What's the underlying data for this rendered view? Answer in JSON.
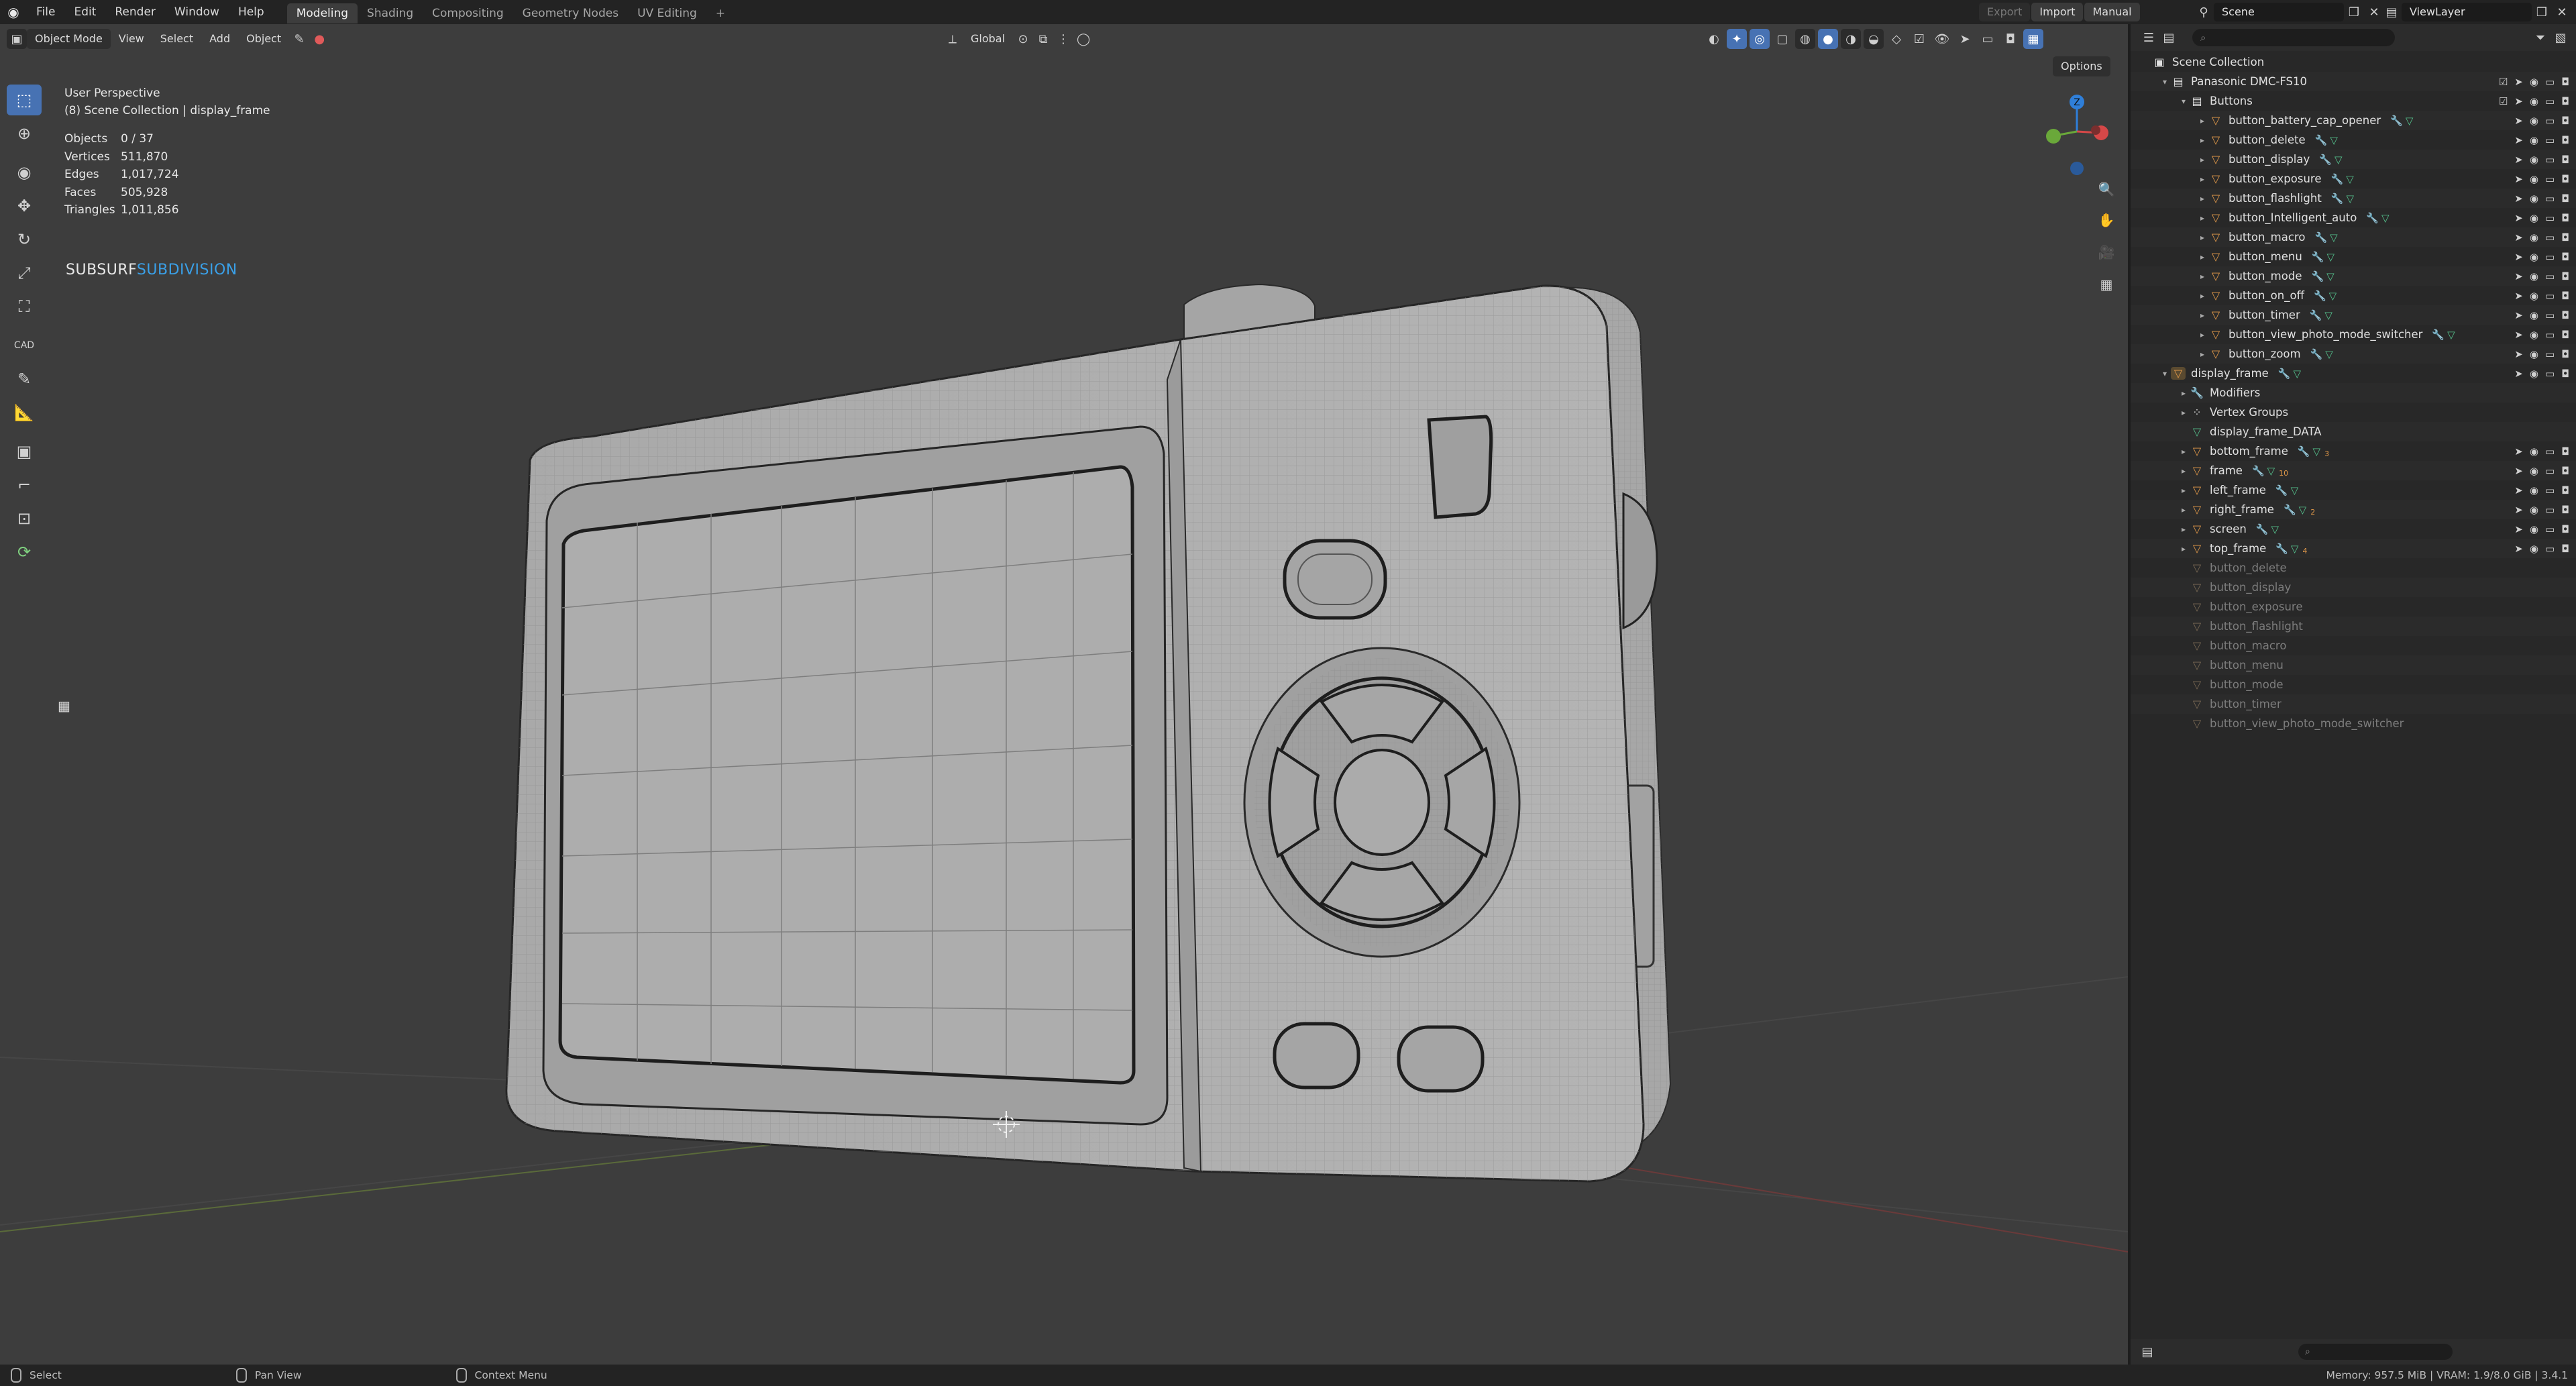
{
  "menubar": {
    "items": [
      "File",
      "Edit",
      "Render",
      "Window",
      "Help"
    ],
    "workspaces": [
      "Modeling",
      "Shading",
      "Compositing",
      "Geometry Nodes",
      "UV Editing"
    ],
    "active_workspace": "Modeling",
    "add_tab": "+",
    "export_label": "Export",
    "import_label": "Import",
    "manual_label": "Manual",
    "scene_name": "Scene",
    "view_layer": "ViewLayer"
  },
  "viewport_header": {
    "mode": "Object Mode",
    "menus": [
      "View",
      "Select",
      "Add",
      "Object"
    ],
    "transform_orientation": "Global",
    "options_label": "Options"
  },
  "viewport_overlay": {
    "view_name": "User Perspective",
    "collection_line": "(8) Scene Collection | display_frame",
    "stats": [
      {
        "label": "Objects",
        "value": "0 / 37"
      },
      {
        "label": "Vertices",
        "value": "511,870"
      },
      {
        "label": "Edges",
        "value": "1,017,724"
      },
      {
        "label": "Faces",
        "value": "505,928"
      },
      {
        "label": "Triangles",
        "value": "1,011,856"
      }
    ],
    "addon_label_a": "SUBSURF",
    "addon_label_b": "SUBDIVISION",
    "gizmo_axis_z": "Z"
  },
  "toolbar": {
    "tools": [
      "select-box",
      "cursor",
      "move-circle",
      "move",
      "rotate",
      "scale",
      "transform",
      "cad",
      "annotate",
      "measure",
      "add-cube",
      "bend",
      "shrink",
      "spin"
    ]
  },
  "outliner": {
    "rows": [
      {
        "label": "Scene Collection",
        "depth": 0,
        "kind": "scene",
        "arrow": ""
      },
      {
        "label": "Panasonic DMC-FS10",
        "depth": 1,
        "kind": "collection",
        "arrow": "▾"
      },
      {
        "label": "Buttons",
        "depth": 2,
        "kind": "collection",
        "arrow": "▾"
      },
      {
        "label": "button_battery_cap_opener",
        "depth": 3,
        "kind": "mesh",
        "arrow": "▸"
      },
      {
        "label": "button_delete",
        "depth": 3,
        "kind": "mesh",
        "arrow": "▸"
      },
      {
        "label": "button_display",
        "depth": 3,
        "kind": "mesh",
        "arrow": "▸"
      },
      {
        "label": "button_exposure",
        "depth": 3,
        "kind": "mesh",
        "arrow": "▸"
      },
      {
        "label": "button_flashlight",
        "depth": 3,
        "kind": "mesh",
        "arrow": "▸"
      },
      {
        "label": "button_Intelligent_auto",
        "depth": 3,
        "kind": "mesh",
        "arrow": "▸"
      },
      {
        "label": "button_macro",
        "depth": 3,
        "kind": "mesh",
        "arrow": "▸"
      },
      {
        "label": "button_menu",
        "depth": 3,
        "kind": "mesh",
        "arrow": "▸"
      },
      {
        "label": "button_mode",
        "depth": 3,
        "kind": "mesh",
        "arrow": "▸"
      },
      {
        "label": "button_on_off",
        "depth": 3,
        "kind": "mesh",
        "arrow": "▸"
      },
      {
        "label": "button_timer",
        "depth": 3,
        "kind": "mesh",
        "arrow": "▸"
      },
      {
        "label": "button_view_photo_mode_switcher",
        "depth": 3,
        "kind": "mesh",
        "arrow": "▸"
      },
      {
        "label": "button_zoom",
        "depth": 3,
        "kind": "mesh",
        "arrow": "▸"
      },
      {
        "label": "display_frame",
        "depth": 1,
        "kind": "mesh-sel",
        "arrow": "▾"
      },
      {
        "label": "Modifiers",
        "depth": 2,
        "kind": "modifier",
        "arrow": "▸"
      },
      {
        "label": "Vertex Groups",
        "depth": 2,
        "kind": "vgroup",
        "arrow": "▸"
      },
      {
        "label": "display_frame_DATA",
        "depth": 2,
        "kind": "data",
        "arrow": ""
      },
      {
        "label": "bottom_frame",
        "depth": 2,
        "kind": "mesh",
        "arrow": "▸"
      },
      {
        "label": "frame",
        "depth": 2,
        "kind": "mesh",
        "arrow": "▸"
      },
      {
        "label": "left_frame",
        "depth": 2,
        "kind": "mesh",
        "arrow": "▸"
      },
      {
        "label": "right_frame",
        "depth": 2,
        "kind": "mesh",
        "arrow": "▸"
      },
      {
        "label": "screen",
        "depth": 2,
        "kind": "mesh",
        "arrow": "▸"
      },
      {
        "label": "top_frame",
        "depth": 2,
        "kind": "mesh",
        "arrow": "▸"
      },
      {
        "label": "button_delete",
        "depth": 2,
        "kind": "ghost",
        "arrow": ""
      },
      {
        "label": "button_display",
        "depth": 2,
        "kind": "ghost",
        "arrow": ""
      },
      {
        "label": "button_exposure",
        "depth": 2,
        "kind": "ghost",
        "arrow": ""
      },
      {
        "label": "button_flashlight",
        "depth": 2,
        "kind": "ghost",
        "arrow": ""
      },
      {
        "label": "button_macro",
        "depth": 2,
        "kind": "ghost",
        "arrow": ""
      },
      {
        "label": "button_menu",
        "depth": 2,
        "kind": "ghost",
        "arrow": ""
      },
      {
        "label": "button_mode",
        "depth": 2,
        "kind": "ghost",
        "arrow": ""
      },
      {
        "label": "button_timer",
        "depth": 2,
        "kind": "ghost",
        "arrow": ""
      },
      {
        "label": "button_view_photo_mode_switcher",
        "depth": 2,
        "kind": "ghost",
        "arrow": ""
      }
    ],
    "subscript_counts": {
      "frame": "10",
      "right_frame": "2",
      "top_frame": "4",
      "bottom_frame": "3"
    }
  },
  "statusbar": {
    "select": "Select",
    "pan": "Pan View",
    "context": "Context Menu",
    "memory": "Memory: 957.5 MiB | VRAM: 1.9/8.0 GiB | 3.4.1"
  },
  "colors": {
    "accent": "#4772b3",
    "subdivision": "#3aa0e8",
    "mesh_icon": "#e39a4a",
    "viewport_bg": "#3d3d3d"
  }
}
